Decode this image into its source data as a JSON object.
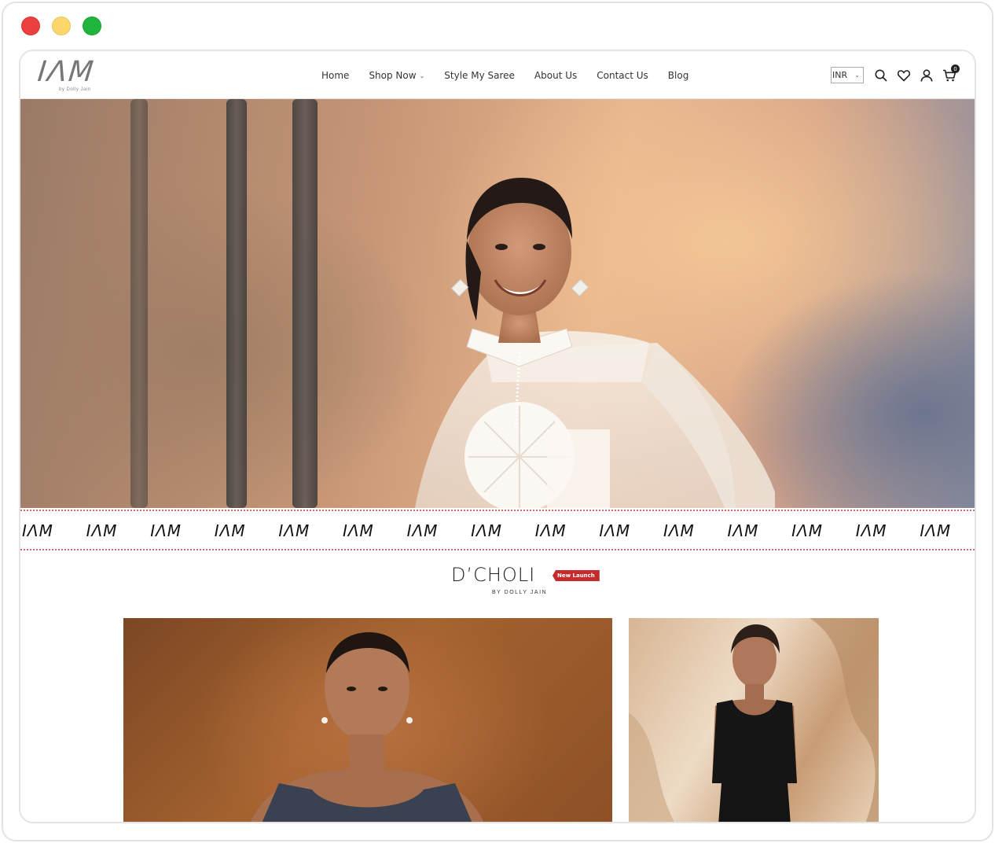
{
  "window": {
    "traffic_lights": [
      "#ec3f3f",
      "#fdd76b",
      "#1fb53c"
    ]
  },
  "header": {
    "logo": {
      "mark": "IΛM",
      "sub": "by Dolly Jain"
    },
    "nav": [
      {
        "label": "Home"
      },
      {
        "label": "Shop Now",
        "has_dropdown": true
      },
      {
        "label": "Style My Saree"
      },
      {
        "label": "About Us"
      },
      {
        "label": "Contact Us"
      },
      {
        "label": "Blog"
      }
    ],
    "currency": "INR",
    "icons": [
      "search-icon",
      "wishlist-heart-icon",
      "account-user-icon",
      "cart-icon"
    ],
    "cart_count": "0"
  },
  "marquee": {
    "brand": "IΛM",
    "repeat": 15,
    "border_color": "#c96b6b"
  },
  "collection": {
    "title": "D’CHOLI",
    "subtitle": "BY DOLLY JAIN",
    "badge": "New Launch",
    "badge_color": "#c62a2a"
  }
}
